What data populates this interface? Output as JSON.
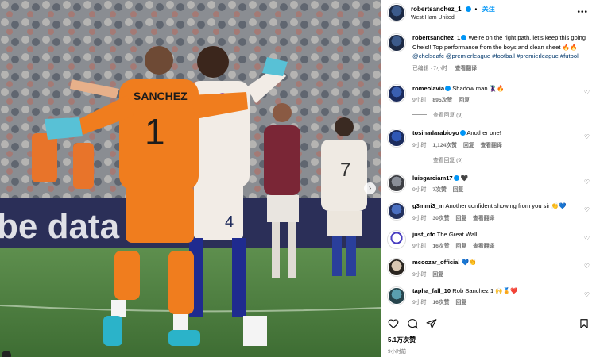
{
  "header": {
    "username": "robertsanchez_1",
    "follow_label": "关注",
    "subtitle": "West Ham United",
    "separator": "•",
    "more_icon": "more-horizontal-icon"
  },
  "caption": {
    "username": "robertsanchez_1",
    "text": "We’re on the right path, let’s keep this going Chels!! Top performance from the boys and clean sheet 🔥🔥",
    "tags": "@chelseafc @premierleague #football #premierleague #futbol",
    "meta": "已编辑 · 7小时",
    "translate": "查看翻译"
  },
  "comments": [
    {
      "username": "romeolavia",
      "text": "Shadow man 🦹‍♂️🔥",
      "time": "9小时",
      "likes": "895次赞",
      "reply": "回复",
      "translate": "",
      "replies": "查看回复 (9)"
    },
    {
      "username": "tosinadarabioyo",
      "text": "Another one!",
      "time": "9小时",
      "likes": "1,124次赞",
      "reply": "回复",
      "translate": "查看翻译",
      "replies": "查看回复 (9)"
    },
    {
      "username": "luisgarciam17",
      "text": "🖤",
      "time": "9小时",
      "likes": "7次赞",
      "reply": "回复",
      "translate": "",
      "replies": ""
    },
    {
      "username": "g3mmi3_m",
      "text": "Another confident showing from you sir 👏💙",
      "time": "9小时",
      "likes": "30次赞",
      "reply": "回复",
      "translate": "查看翻译",
      "replies": ""
    },
    {
      "username": "just_cfc",
      "text": "The Great Wall!",
      "time": "9小时",
      "likes": "16次赞",
      "reply": "回复",
      "translate": "查看翻译",
      "replies": ""
    },
    {
      "username": "mccozar_official",
      "text": "💙👏",
      "time": "9小时",
      "likes": "",
      "reply": "回复",
      "translate": "",
      "replies": ""
    },
    {
      "username": "tapha_fall_10",
      "text": "Rob Sanchez 1 🙌🏅❤️",
      "time": "9小时",
      "likes": "16次赞",
      "reply": "回复",
      "translate": "",
      "replies": ""
    }
  ],
  "actions": {
    "likes": "5.1万次赞",
    "ago": "9小时前"
  },
  "media": {
    "jersey_name": "SANCHEZ",
    "jersey_number_gk": "1",
    "jersey_number_player": "4",
    "jersey_number_bg": "7",
    "board_text": "be data d",
    "next_icon": "chevron-right-icon"
  },
  "colors": {
    "accent": "#0095f6",
    "gk_orange": "#f07d1e",
    "chelsea_white": "#f2ece6",
    "west_ham_claret": "#7a2636"
  }
}
